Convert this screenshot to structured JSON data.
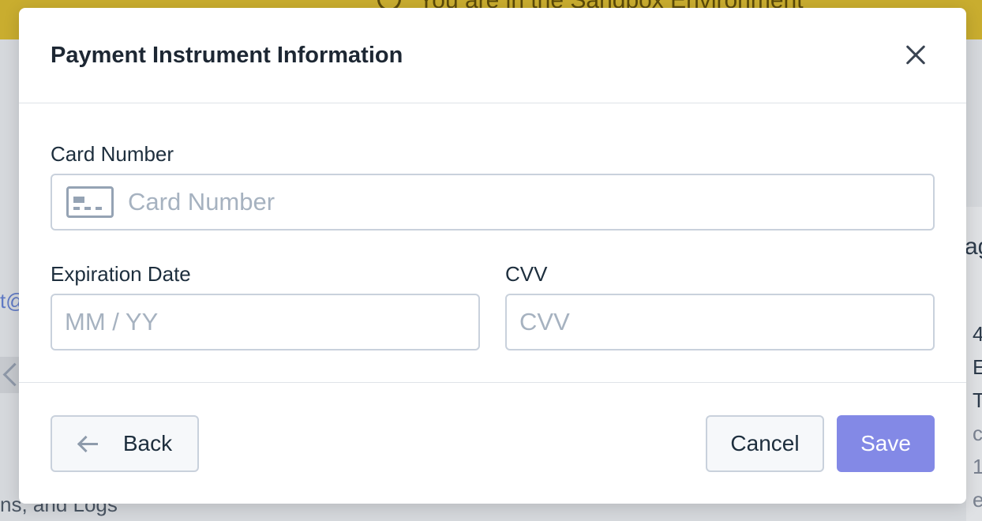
{
  "background": {
    "banner_text": "You are in the Sandbox Environment",
    "left_link_fragment": "t@",
    "bottom_text_fragment": "ns, and Logs",
    "right_heading_fragment": "ag",
    "right_lines": [
      "4",
      "E",
      "T",
      "c",
      "1",
      "e"
    ]
  },
  "modal": {
    "title": "Payment Instrument Information",
    "card_number": {
      "label": "Card Number",
      "placeholder": "Card Number",
      "value": "",
      "icon": "credit-card-icon"
    },
    "expiration_date": {
      "label": "Expiration Date",
      "placeholder": "MM / YY",
      "value": ""
    },
    "cvv": {
      "label": "CVV",
      "placeholder": "CVV",
      "value": ""
    },
    "footer": {
      "back_label": "Back",
      "cancel_label": "Cancel",
      "save_label": "Save"
    }
  },
  "colors": {
    "banner": "#c9ad2f",
    "save_button": "#8389e6",
    "input_border": "#c9d1dc",
    "placeholder": "#a6b2c0"
  }
}
